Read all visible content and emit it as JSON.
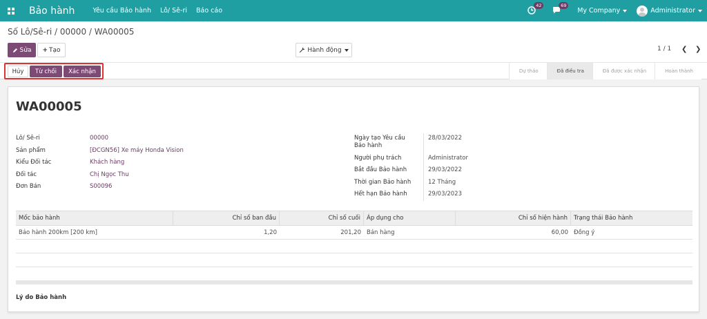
{
  "navbar": {
    "app_title": "Bảo hành",
    "menu": [
      "Yêu cầu Bảo hành",
      "Lô/ Sê-ri",
      "Báo cáo"
    ],
    "activity_count": "42",
    "message_count": "69",
    "company": "My Company",
    "user": "Administrator"
  },
  "breadcrumb": {
    "level1": "Số Lô/Sê-ri",
    "sep1": " / ",
    "level2": "00000",
    "sep2": " / ",
    "current": "WA00005"
  },
  "toolbar": {
    "edit_label": "Sửa",
    "create_label": "Tạo",
    "action_label": "Hành động",
    "pager": "1 / 1"
  },
  "status_buttons": {
    "cancel": "Hủy",
    "refuse": "Từ chối",
    "confirm": "Xác nhận"
  },
  "stages": [
    "Dự thảo",
    "Đã điều tra",
    "Đã được xác nhận",
    "Hoàn thành"
  ],
  "active_stage": "Đã điều tra",
  "record": {
    "name": "WA00005",
    "left_fields": [
      {
        "label": "Lô/ Sê-ri",
        "value": "00000"
      },
      {
        "label": "Sản phẩm",
        "value": "[ĐCGN56] Xe máy Honda Vision"
      },
      {
        "label": "Kiểu Đối tác",
        "value": "Khách hàng"
      },
      {
        "label": "Đối tác",
        "value": "Chị Ngọc Thu"
      },
      {
        "label": "Đơn Bán",
        "value": "S00096"
      }
    ],
    "right_fields": [
      {
        "label": "Ngày tạo Yêu cầu Bảo hành",
        "label_line1": "Ngày tạo Yêu cầu",
        "label_line2": "Bảo hành",
        "value": "28/03/2022"
      },
      {
        "label": "Người phụ trách",
        "value": "Administrator"
      },
      {
        "label": "Bắt đầu Bảo hành",
        "value": "29/03/2022"
      },
      {
        "label": "Thời gian Bảo hành",
        "value": "12 Tháng"
      },
      {
        "label": "Hết hạn Bảo hành",
        "value": "29/03/2023"
      }
    ]
  },
  "table": {
    "headers": [
      "Mốc bảo hành",
      "Chỉ số ban đầu",
      "Chỉ số cuối",
      "Áp dụng cho",
      "Chỉ số hiện hành",
      "Trạng thái Bảo hành"
    ],
    "rows": [
      [
        "Bảo hành 200km [200 km]",
        "1,20",
        "201,20",
        "Bán hàng",
        "60,00",
        "Đồng ý"
      ]
    ]
  },
  "reason_label": "Lý do Bảo hành",
  "colors": {
    "navbar": "#1f9fa2",
    "primary": "#7c4a74",
    "highlight_box": "#e03131"
  }
}
